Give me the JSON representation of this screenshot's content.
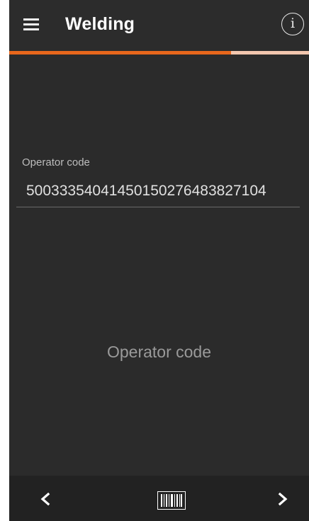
{
  "app": {
    "title": "Welding"
  },
  "progress": {
    "value_percent": 74,
    "fill_color": "#e8671c",
    "track_color": "#f2c6ae"
  },
  "icons": {
    "menu": "hamburger-menu-icon",
    "info": "info-circle-icon",
    "info_glyph": "i",
    "prev": "chevron-left-icon",
    "barcode": "barcode-icon",
    "next": "chevron-right-icon"
  },
  "form": {
    "operator_label": "Operator code",
    "operator_value": "500333540414501502764838271​04"
  },
  "prompt": {
    "text": "Operator code"
  }
}
